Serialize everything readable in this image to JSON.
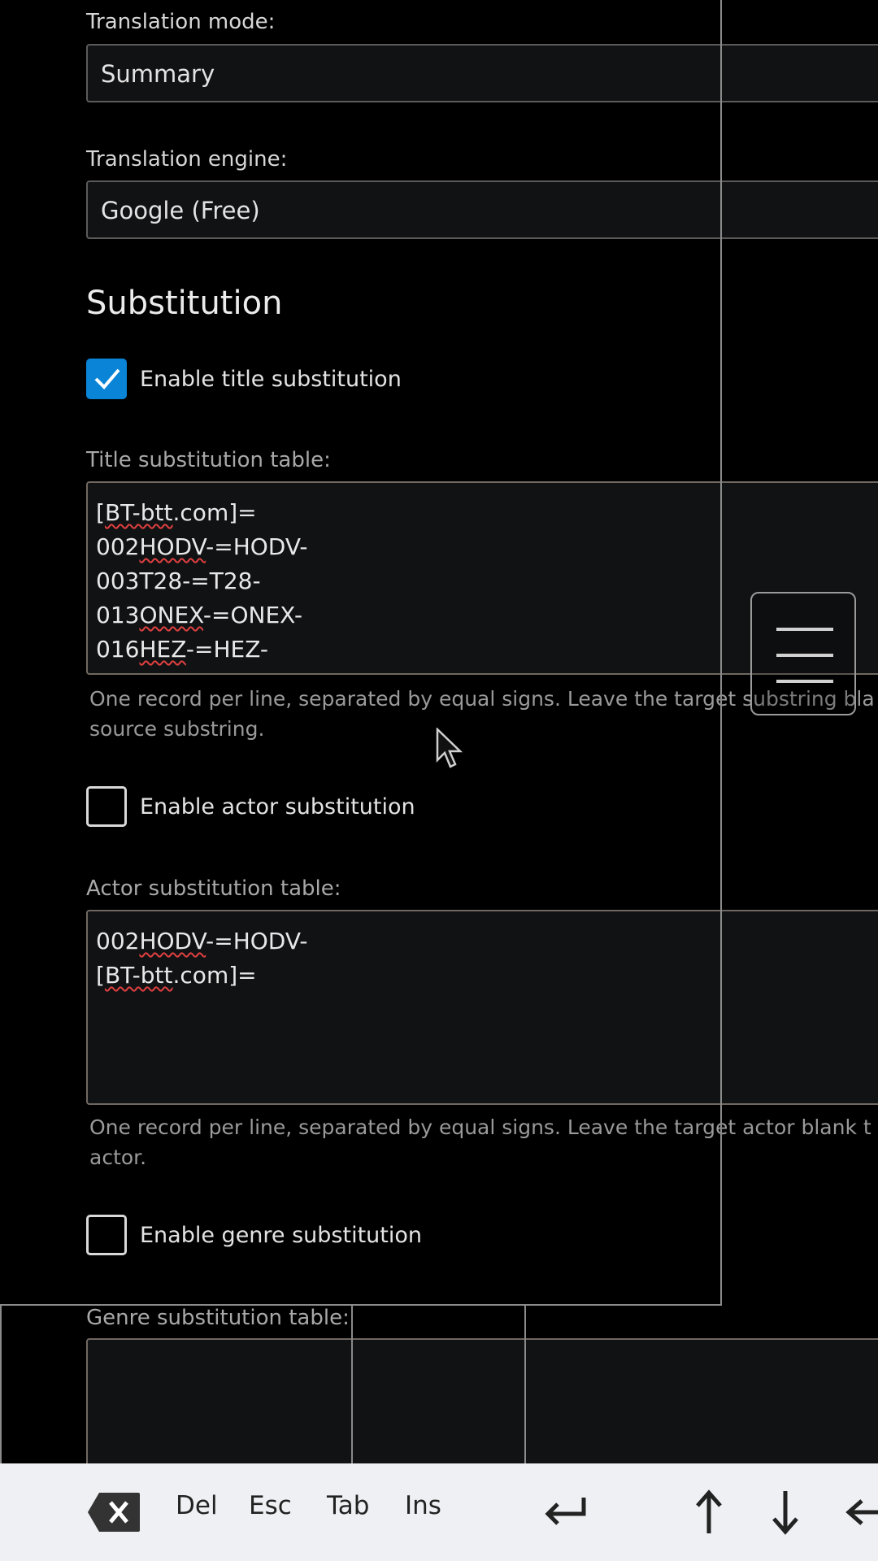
{
  "translation_mode": {
    "label": "Translation mode:",
    "value": "Summary"
  },
  "translation_engine": {
    "label": "Translation engine:",
    "value": "Google (Free)"
  },
  "substitution": {
    "title": "Substitution",
    "title_sub": {
      "checkbox_label": "Enable title substitution",
      "checked": true,
      "table_label": "Title substitution table:",
      "lines": [
        "[BT-btt.com]=",
        "002HODV-=HODV-",
        "003T28-=T28-",
        "013ONEX-=ONEX-",
        "016HEZ-=HEZ-"
      ],
      "help_line1": "One record per line, separated by equal signs. Leave the target substring bla",
      "help_line2": "source substring."
    },
    "actor_sub": {
      "checkbox_label": "Enable actor substitution",
      "checked": false,
      "table_label": "Actor substitution table:",
      "lines": [
        "002HODV-=HODV-",
        "[BT-btt.com]="
      ],
      "help_line1": "One record per line, separated by equal signs. Leave the target actor blank t",
      "help_line2": "actor."
    },
    "genre_sub": {
      "checkbox_label": "Enable genre substitution",
      "checked": false,
      "table_label": "Genre substitution table:"
    }
  },
  "keyboard_bar": {
    "keys": [
      "Del",
      "Esc",
      "Tab",
      "Ins"
    ],
    "icons": [
      "backspace-icon",
      "enter-icon",
      "arrow-up-icon",
      "arrow-down-icon",
      "arrow-left-icon"
    ]
  },
  "colors": {
    "accent": "#0a84d6",
    "background": "#000000",
    "field": "#111214",
    "keybar": "#eef0f3"
  }
}
